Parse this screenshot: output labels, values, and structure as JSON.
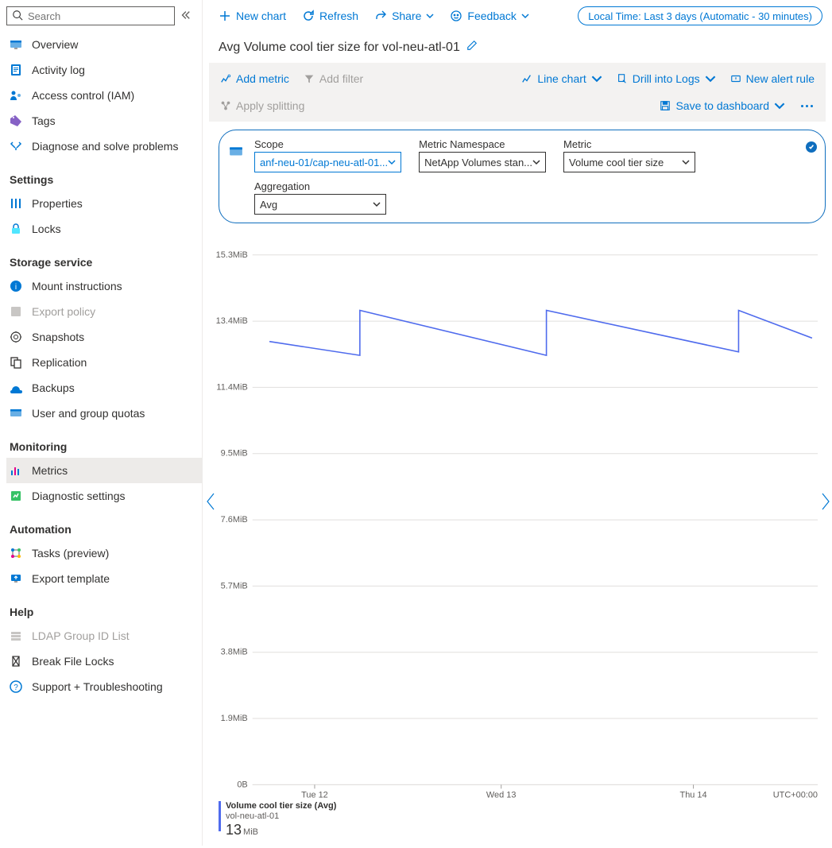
{
  "search_placeholder": "Search",
  "sidebar": {
    "items": [
      {
        "label": "Overview"
      },
      {
        "label": "Activity log"
      },
      {
        "label": "Access control (IAM)"
      },
      {
        "label": "Tags"
      },
      {
        "label": "Diagnose and solve problems"
      }
    ],
    "settings_heading": "Settings",
    "settings": [
      {
        "label": "Properties"
      },
      {
        "label": "Locks"
      }
    ],
    "storage_heading": "Storage service",
    "storage": [
      {
        "label": "Mount instructions"
      },
      {
        "label": "Export policy"
      },
      {
        "label": "Snapshots"
      },
      {
        "label": "Replication"
      },
      {
        "label": "Backups"
      },
      {
        "label": "User and group quotas"
      }
    ],
    "monitoring_heading": "Monitoring",
    "monitoring": [
      {
        "label": "Metrics"
      },
      {
        "label": "Diagnostic settings"
      }
    ],
    "automation_heading": "Automation",
    "automation": [
      {
        "label": "Tasks (preview)"
      },
      {
        "label": "Export template"
      }
    ],
    "help_heading": "Help",
    "help": [
      {
        "label": "LDAP Group ID List"
      },
      {
        "label": "Break File Locks"
      },
      {
        "label": "Support + Troubleshooting"
      }
    ]
  },
  "topbar": {
    "new_chart": "New chart",
    "refresh": "Refresh",
    "share": "Share",
    "feedback": "Feedback",
    "time_pill": "Local Time: Last 3 days (Automatic - 30 minutes)"
  },
  "title": "Avg Volume cool tier size for vol-neu-atl-01",
  "toolbar": {
    "add_metric": "Add metric",
    "add_filter": "Add filter",
    "apply_splitting": "Apply splitting",
    "line_chart": "Line chart",
    "drill": "Drill into Logs",
    "new_alert": "New alert rule",
    "save": "Save to dashboard"
  },
  "config": {
    "scope_label": "Scope",
    "scope_value": "anf-neu-01/cap-neu-atl-01...",
    "namespace_label": "Metric Namespace",
    "namespace_value": "NetApp Volumes stan...",
    "metric_label": "Metric",
    "metric_value": "Volume cool tier size",
    "aggregation_label": "Aggregation",
    "aggregation_value": "Avg"
  },
  "chart_data": {
    "type": "line",
    "title": "Avg Volume cool tier size for vol-neu-atl-01",
    "ylabel": "",
    "y_ticks": [
      "0B",
      "1.9MiB",
      "3.8MiB",
      "5.7MiB",
      "7.6MiB",
      "9.5MiB",
      "11.4MiB",
      "13.4MiB",
      "15.3MiB"
    ],
    "ylim": [
      0,
      15.3
    ],
    "x_ticks": [
      "Tue 12",
      "Wed 13",
      "Thu 14"
    ],
    "utc": "UTC+00:00",
    "series": [
      {
        "name": "Volume cool tier size (Avg)",
        "resource": "vol-neu-atl-01",
        "color": "#4f6bed",
        "x": [
          0.03,
          0.19,
          0.19,
          0.52,
          0.52,
          0.86,
          0.86,
          0.99
        ],
        "y": [
          12.8,
          12.4,
          13.7,
          12.4,
          13.7,
          12.5,
          13.7,
          12.9
        ]
      }
    ]
  },
  "legend": {
    "line1": "Volume cool tier size (Avg)",
    "line2": "vol-neu-atl-01",
    "value": "13",
    "unit": "MiB"
  }
}
